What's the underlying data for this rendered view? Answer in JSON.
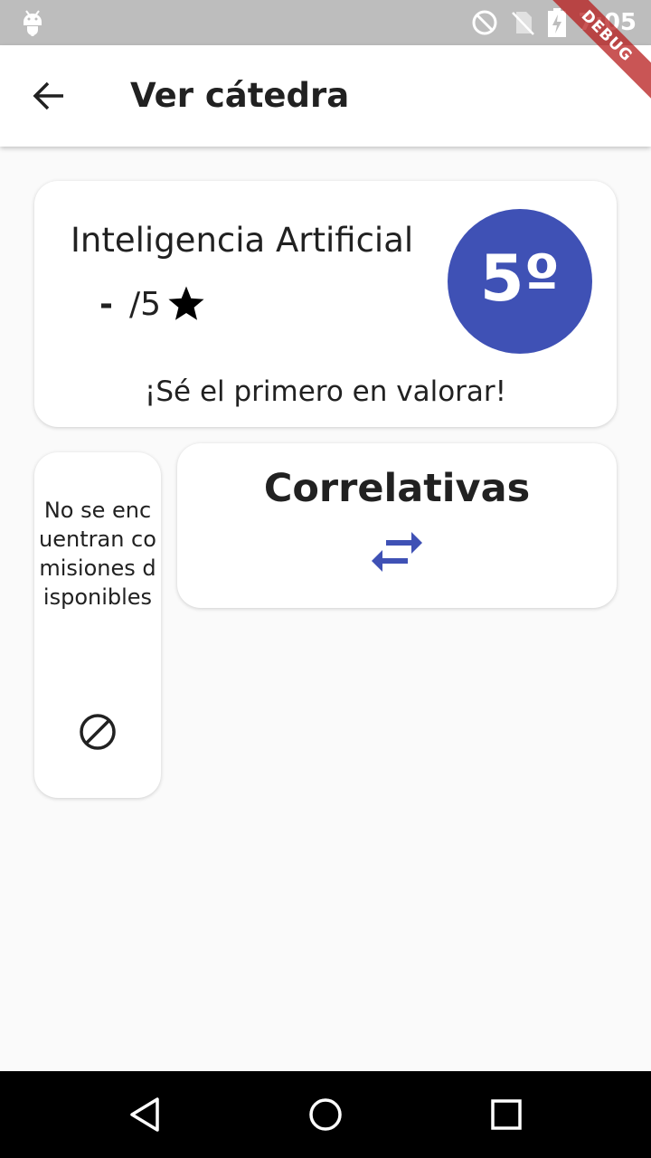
{
  "status_bar": {
    "time": "7:05",
    "icons": [
      "android-icon",
      "do-not-disturb-icon",
      "no-sim-icon",
      "battery-charging-icon"
    ]
  },
  "debug_banner": {
    "label": "DEBUG"
  },
  "app_bar": {
    "title": "Ver cátedra",
    "back_icon": "arrow-back-icon"
  },
  "course_card": {
    "name": "Inteligencia Artificial",
    "rating_value": "-",
    "rating_suffix": "/5",
    "rating_icon": "star-icon",
    "level": "5º",
    "first_rate_prompt": "¡Sé el primero en valorar!"
  },
  "commissions_card": {
    "message": "No se encuentran comisiones disponibles",
    "icon": "block-icon"
  },
  "correlatives_card": {
    "title": "Correlativas",
    "icon": "swap-arrows-icon"
  },
  "nav_bar": {
    "buttons": [
      "nav-back-icon",
      "nav-home-icon",
      "nav-recents-icon"
    ]
  },
  "colors": {
    "primary": "#3f51b5",
    "status_bar": "#bdbdbd",
    "background": "#fafafa",
    "text": "#212121",
    "debug_banner": "#b71c1c"
  }
}
